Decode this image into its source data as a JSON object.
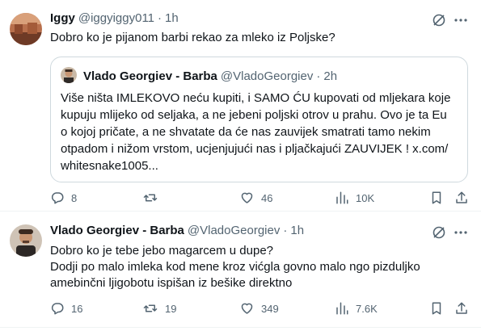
{
  "tweet1": {
    "name": "Iggy",
    "handle": "@iggyiggy011",
    "sep": "·",
    "time": "1h",
    "text": "Dobro ko je pijanom barbi rekao za mleko iz Poljske?",
    "quote": {
      "name": "Vlado Georgiev - Barba",
      "handle": "@VladoGeorgiev",
      "sep": "·",
      "time": "2h",
      "lines": [
        "Više ništa IMLEKOVO neću kupiti, i SAMO ĆU kupovati od mljekara koje",
        "kupuju mlijeko od seljaka, a ne jebeni poljski otrov u prahu. Ovo je ta Eu",
        "o kojoj pričate, a ne shvatate da će nas zauvijek smatrati tamo nekim",
        "otpadom i nižom vrstom, ucjenjujući nas i pljačkajući ZAUVIJEK ! x.com/",
        "whitesnake1005..."
      ]
    },
    "actions": {
      "replies": "8",
      "reposts": "",
      "likes": "46",
      "views": "10K"
    }
  },
  "tweet2": {
    "name": "Vlado Georgiev - Barba",
    "handle": "@VladoGeorgiev",
    "sep": "·",
    "time": "1h",
    "lines": [
      "Dobro ko je tebe jebo magarcem u dupe?",
      "Dodji po malo imleka kod mene kroz vićgla govno malo ngo pizduljko",
      "amebinčni ljigobotu ispišan iz bešike direktno"
    ],
    "actions": {
      "replies": "16",
      "reposts": "19",
      "likes": "349",
      "views": "7.6K"
    }
  },
  "colors": {
    "text": "#0f1419",
    "muted": "#536471",
    "border": "#cfd9de",
    "divider": "#eff3f4"
  },
  "icons": [
    "grok-icon",
    "more-icon",
    "reply-icon",
    "repost-icon",
    "like-icon",
    "views-icon",
    "bookmark-icon",
    "share-icon"
  ]
}
